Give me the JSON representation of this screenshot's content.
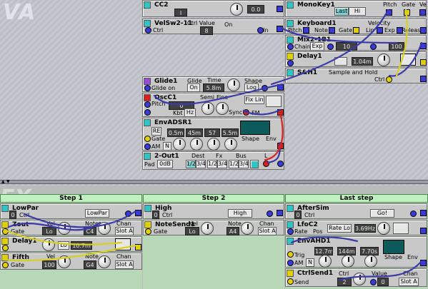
{
  "watermark": "VA",
  "colors": {
    "stripe_cyan": "#31c4c4",
    "stripe_yellow": "#e0d000",
    "stripe_red": "#d82020",
    "stripe_purple": "#9a4cd8",
    "cable_blue": "#3a3aa8",
    "cable_yellow": "#d8d020",
    "step_green": "#c0f0c0"
  },
  "modules": {
    "cc2": {
      "title": "CC2",
      "value": "0.0",
      "disp": "_ ",
      "btn": "I"
    },
    "velsw": {
      "title": "VelSw2-11",
      "ctrl_label": "Ctrl",
      "ctrl_value_label": "Ctrl Value",
      "value": "8",
      "on": "On",
      "in": "In"
    },
    "monokey": {
      "title": "MonoKey1",
      "pitch": "Pitch",
      "gate": "Gate",
      "vel": "Ve",
      "mode": "Last",
      "hi": "Hi"
    },
    "keyboard": {
      "title": "Keyboard1",
      "pitch": "Pitch",
      "note": "Note",
      "gate": "Gate",
      "lin": "Lin",
      "exp": "Exp",
      "release": "Release",
      "velocity": "Velocity"
    },
    "mix": {
      "title": "Mix2-1B1",
      "chain": "Chain",
      "exp": "Exp",
      "value1": "10",
      "value2": "100"
    },
    "delay1_top": {
      "title": "Delay1",
      "value": "1.04m"
    },
    "sh": {
      "title": "S&H1",
      "subtitle": "Sample and Hold",
      "ctrl": "Ctrl"
    },
    "glide": {
      "title": "Glide1",
      "glide_on": "Glide on",
      "glide": "Glide",
      "time": "Time",
      "shape": "Shape",
      "on": "On",
      "time_value": "5.8m",
      "shape_value": "Log"
    },
    "osc": {
      "title": "OscC1",
      "pitch": "Pitch",
      "semi": "Semi",
      "fine": "Fine",
      "sync": "Sync",
      "fm": "FM",
      "kbt": "Kbt",
      "pitch_value": "0",
      "kbt_value": "Hz",
      "fine_value": "Lin",
      "fm_mode": "Fix Lin"
    },
    "env": {
      "title": "EnvADSR1",
      "a": "0.5m",
      "d": "45m",
      "s": "57",
      "r": "5.5m",
      "am": "AM",
      "shape": "Shape",
      "env": "Env",
      "gate": "Gate",
      "n": "N",
      "retrig": "RE"
    },
    "out": {
      "title": "2-Out1",
      "dest": "Dest",
      "fx": "Fx",
      "bus": "Bus",
      "pad": "Pad",
      "pad_value": "0dB",
      "opts": [
        "1/2",
        "3/4",
        "1/2",
        "3/4",
        "1/2",
        "3/4"
      ],
      "l": "L"
    }
  },
  "steps": [
    {
      "label": "Step 1"
    },
    {
      "label": "Step 2"
    },
    {
      "label": "Last step"
    }
  ],
  "lower": {
    "lowpar": {
      "title": "LowPar",
      "ctrl": "Ctrl",
      "value": "0",
      "disp": "LowPar"
    },
    "high": {
      "title": "High",
      "ctrl": "Ctrl",
      "value": "0",
      "disp": "High"
    },
    "aftersim": {
      "title": "AfterSim",
      "ctrl": "Ctrl",
      "value": "0",
      "disp": "Go!"
    },
    "zout": {
      "title": "Zout",
      "vel": "Vel",
      "note": "Note",
      "chan": "Chan",
      "gate": "Gate",
      "vel_value": "Lo",
      "note_value": "C4",
      "chan_value": "Slot A"
    },
    "notesend": {
      "title": "NoteSend1",
      "vel": "Vel",
      "note": "Note",
      "chan": "Chan",
      "gate": "Gate",
      "vel_value": "Lo",
      "note_value": "A4",
      "chan_value": "Slot A"
    },
    "lfoc": {
      "title": "LfoC2",
      "rate": "Rate",
      "rate_mode": "Rate Lo",
      "rate_value": "3.69Hz",
      "pos": "Pos"
    },
    "delay1": {
      "title": "Delay1",
      "value": "10.7m",
      "lo": "Lo"
    },
    "envahd": {
      "title": "EnvAHD1",
      "a": "12.7m",
      "h": "144m",
      "d": "7.70s",
      "trig": "Trig",
      "shape": "Shape",
      "env": "Env",
      "am": "AM",
      "n": "N"
    },
    "fifth": {
      "title": "Fifth",
      "vel": "Vel",
      "note": "Note",
      "chan": "Chan",
      "gate": "Gate",
      "vel_value": "100",
      "note_value": "G4",
      "chan_value": "Slot A"
    },
    "ctrlsend": {
      "title": "CtrlSend1",
      "ctrl": "Ctrl",
      "value": "Value",
      "chan": "Chan",
      "send": "Send",
      "ctrl_value": "2",
      "value_value": "0",
      "chan_value": "Slot A"
    }
  }
}
